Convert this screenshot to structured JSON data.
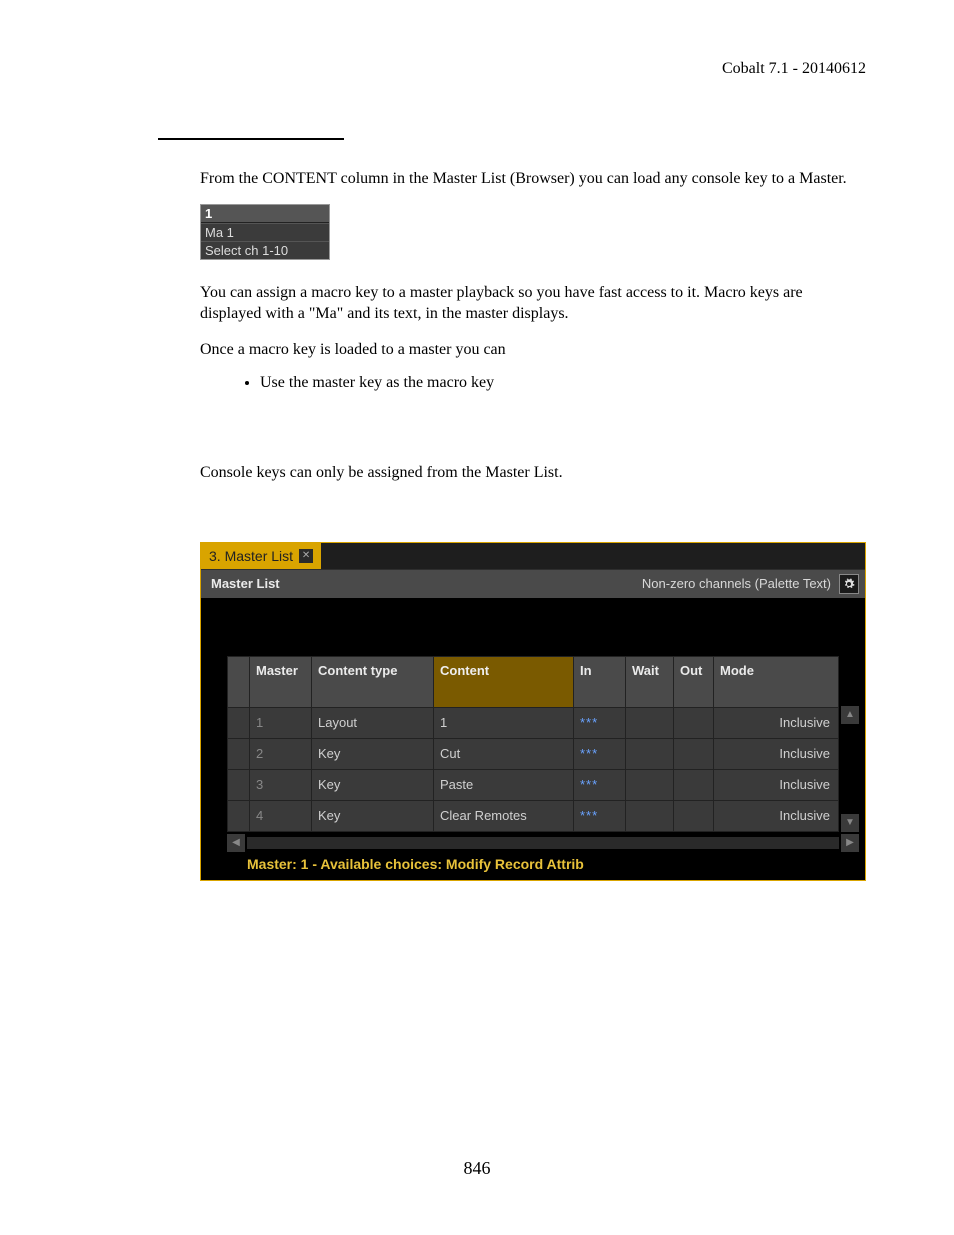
{
  "doc": {
    "header": "Cobalt 7.1 - 20140612",
    "page_number": "846",
    "p1": "From the CONTENT column in the Master List (Browser) you can load any console key to a Master.",
    "p2": "You can assign a macro key to a master playback so you have fast access to it. Macro keys are displayed with a \"Ma\" and its text, in the master displays.",
    "p3": "Once a macro key is loaded to a master you can",
    "bullet1": "Use the master key as the macro key",
    "p4": "Console keys can only be assigned from the Master List."
  },
  "mini": {
    "header": "1",
    "row1": "Ma 1",
    "row2": "Select ch 1-10"
  },
  "ml": {
    "tab_label": "3. Master List",
    "header_left": "Master List",
    "header_right": "Non-zero channels (Palette Text)",
    "columns": {
      "master": "Master",
      "ctype": "Content type",
      "content": "Content",
      "in": "In",
      "wait": "Wait",
      "out": "Out",
      "mode": "Mode"
    },
    "rows": [
      {
        "master": "1",
        "ctype": "Layout",
        "content": "1",
        "in": "***",
        "wait": "",
        "out": "",
        "mode": "Inclusive"
      },
      {
        "master": "2",
        "ctype": "Key",
        "content": "Cut",
        "in": "***",
        "wait": "",
        "out": "",
        "mode": "Inclusive"
      },
      {
        "master": "3",
        "ctype": "Key",
        "content": "Paste",
        "in": "***",
        "wait": "",
        "out": "",
        "mode": "Inclusive"
      },
      {
        "master": "4",
        "ctype": "Key",
        "content": "Clear Remotes",
        "in": "***",
        "wait": "",
        "out": "",
        "mode": "Inclusive"
      }
    ],
    "footer": "Master: 1 - Available choices: Modify Record Attrib"
  }
}
